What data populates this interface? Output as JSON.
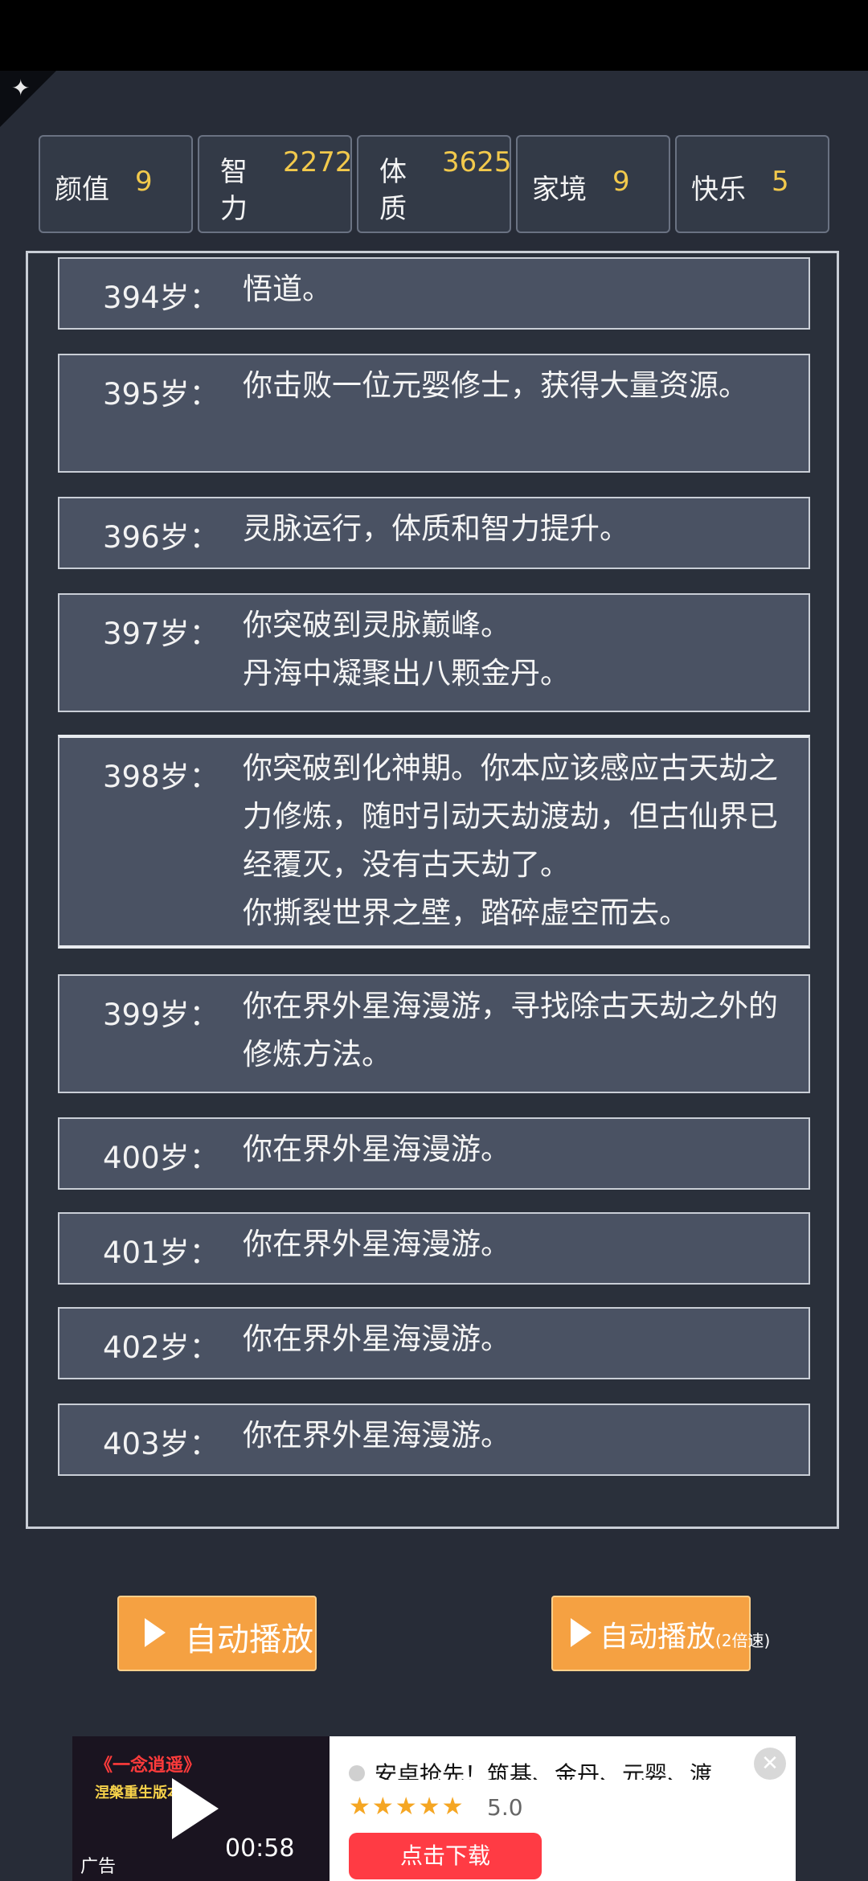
{
  "stats": [
    {
      "label": "颜值",
      "value": "9"
    },
    {
      "label_line1": "智",
      "label_line2": "力",
      "value": "2272"
    },
    {
      "label_line1": "体",
      "label_line2": "质",
      "value": "3625"
    },
    {
      "label": "家境",
      "value": "9"
    },
    {
      "label": "快乐",
      "value": "5"
    }
  ],
  "log": [
    {
      "age": "394岁：",
      "text": "悟道。"
    },
    {
      "age": "395岁：",
      "text": "你击败一位元婴修士，获得大量资源。"
    },
    {
      "age": "396岁：",
      "text": "灵脉运行，体质和智力提升。"
    },
    {
      "age": "397岁：",
      "text": "你突破到灵脉巅峰。\n丹海中凝聚出八颗金丹。"
    },
    {
      "age": "398岁：",
      "text": "你突破到化神期。你本应该感应古天劫之力修炼，随时引动天劫渡劫，但古仙界已经覆灭，没有古天劫了。\n你撕裂世界之壁，踏碎虚空而去。"
    },
    {
      "age": "399岁：",
      "text": "你在界外星海漫游，寻找除古天劫之外的修炼方法。"
    },
    {
      "age": "400岁：",
      "text": "你在界外星海漫游。"
    },
    {
      "age": "401岁：",
      "text": "你在界外星海漫游。"
    },
    {
      "age": "402岁：",
      "text": "你在界外星海漫游。"
    },
    {
      "age": "403岁：",
      "text": "你在界外星海漫游。"
    }
  ],
  "buttons": {
    "autoplay": "自动播放",
    "autoplay_fast": "自动播放",
    "autoplay_fast_sub": "(2倍速)"
  },
  "ad": {
    "video_title": "《一念逍遥》",
    "video_subtitle": "涅槃重生版本",
    "duration": "00:58",
    "label": "广告",
    "headline": "安卓抢先！筑基、金丹、元婴、渡",
    "stars": "★★★★★",
    "rating": "5.0",
    "cta": "点击下载",
    "close_icon": "close-icon"
  }
}
